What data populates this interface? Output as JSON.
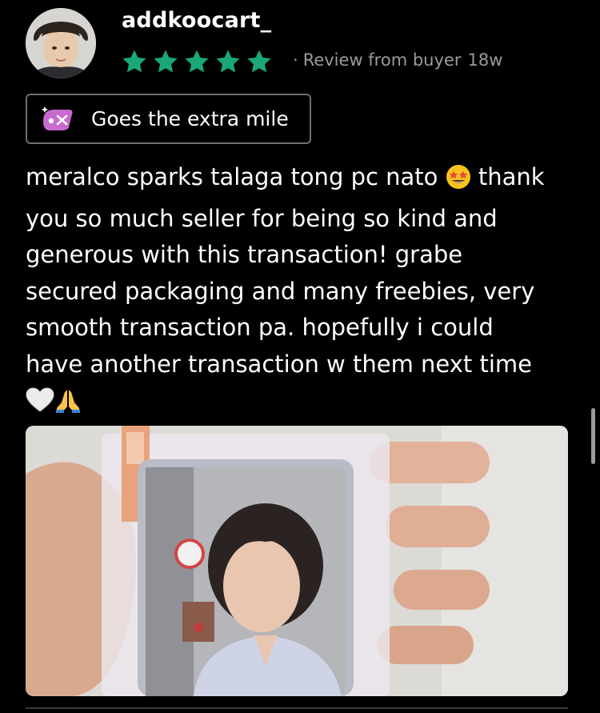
{
  "review": {
    "username": "addkoocart_",
    "rating": 5,
    "rating_max": 5,
    "star_color": "#1aa87a",
    "meta_separator": "·",
    "meta_label": "Review from buyer",
    "age": "18w",
    "badge": {
      "icon": "sparkle-tag-icon",
      "label": "Goes the extra mile"
    },
    "text_lines": [
      "meralco sparks talaga tong pc nato",
      "you so much seller for being so kind and",
      "generous with this transaction! grabe",
      "secured packaging and many freebies, very",
      "smooth transaction pa. hopefully i could",
      "have another transaction w them next time"
    ],
    "text_line1_suffix": "thank",
    "emojis": [
      "star-struck-emoji",
      "white-heart-emoji",
      "folded-hands-emoji"
    ]
  }
}
